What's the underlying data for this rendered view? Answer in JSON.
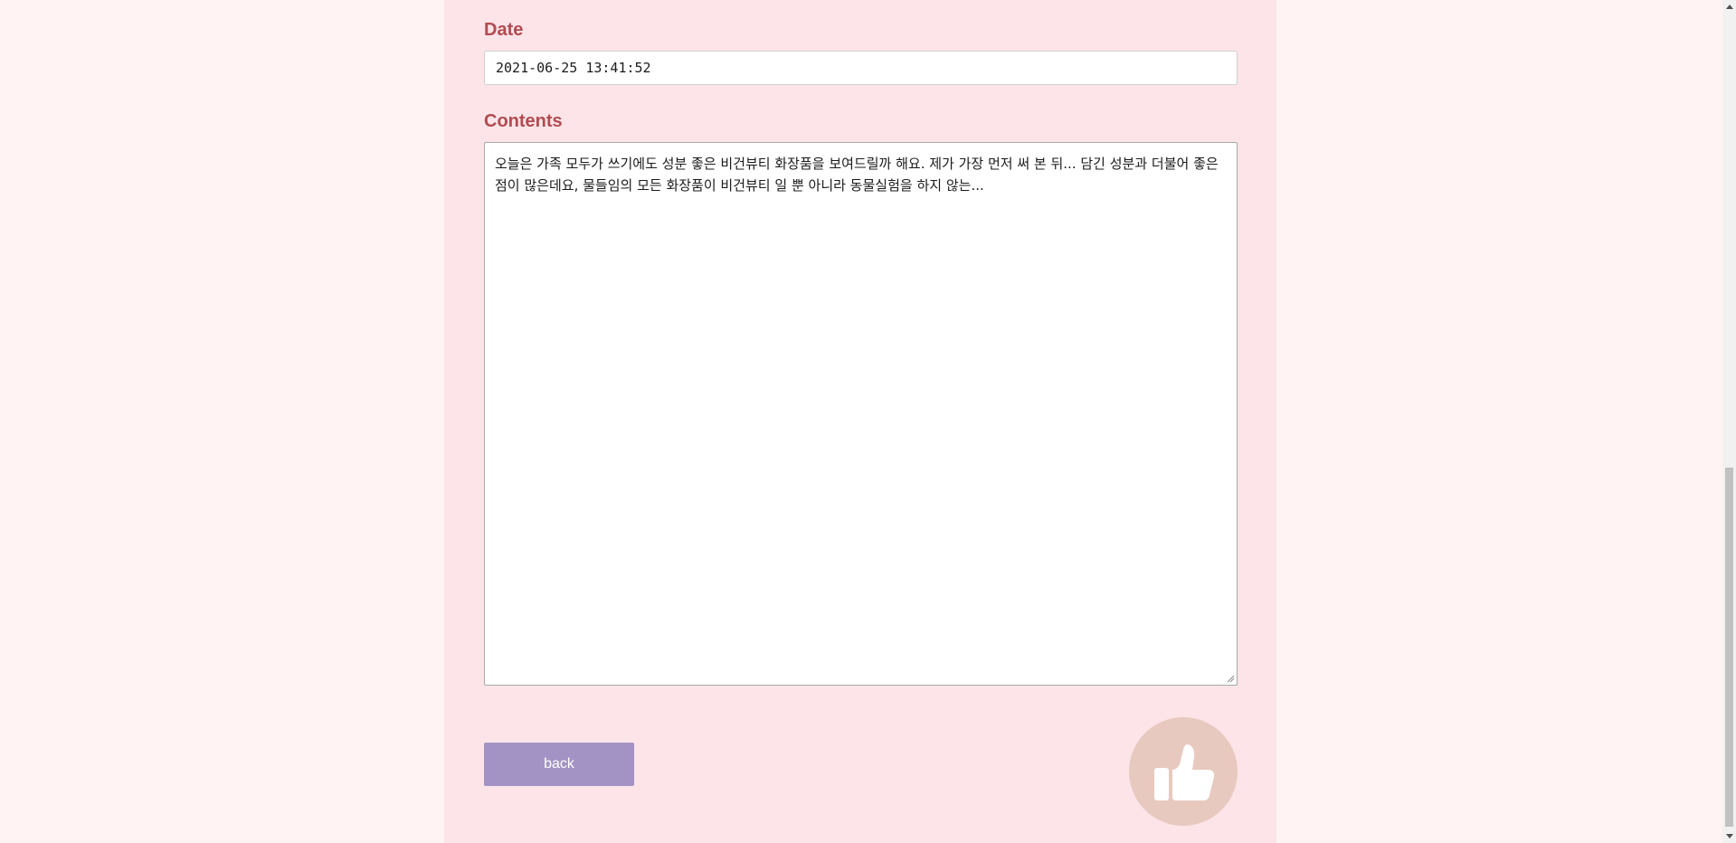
{
  "form": {
    "date_label": "Date",
    "date_value": "2021-06-25 13:41:52",
    "contents_label": "Contents",
    "contents_value": "오늘은 가족 모두가 쓰기에도 성분 좋은 비건뷰티 화장품을 보여드릴까 해요. 제가 가장 먼저 써 본 뒤... 담긴 성분과 더불어 좋은 점이 많은데요, 물들임의 모든 화장품이 비건뷰티 일 뿐 아니라 동물실험을 하지 않는..."
  },
  "actions": {
    "back_label": "back",
    "like_icon": "thumbs-up-icon"
  },
  "colors": {
    "page_bg": "#fff3f4",
    "panel_bg": "#fce4e8",
    "label": "#b14b50",
    "back_button": "#a393c4",
    "like_button": "#e8c9bf"
  }
}
